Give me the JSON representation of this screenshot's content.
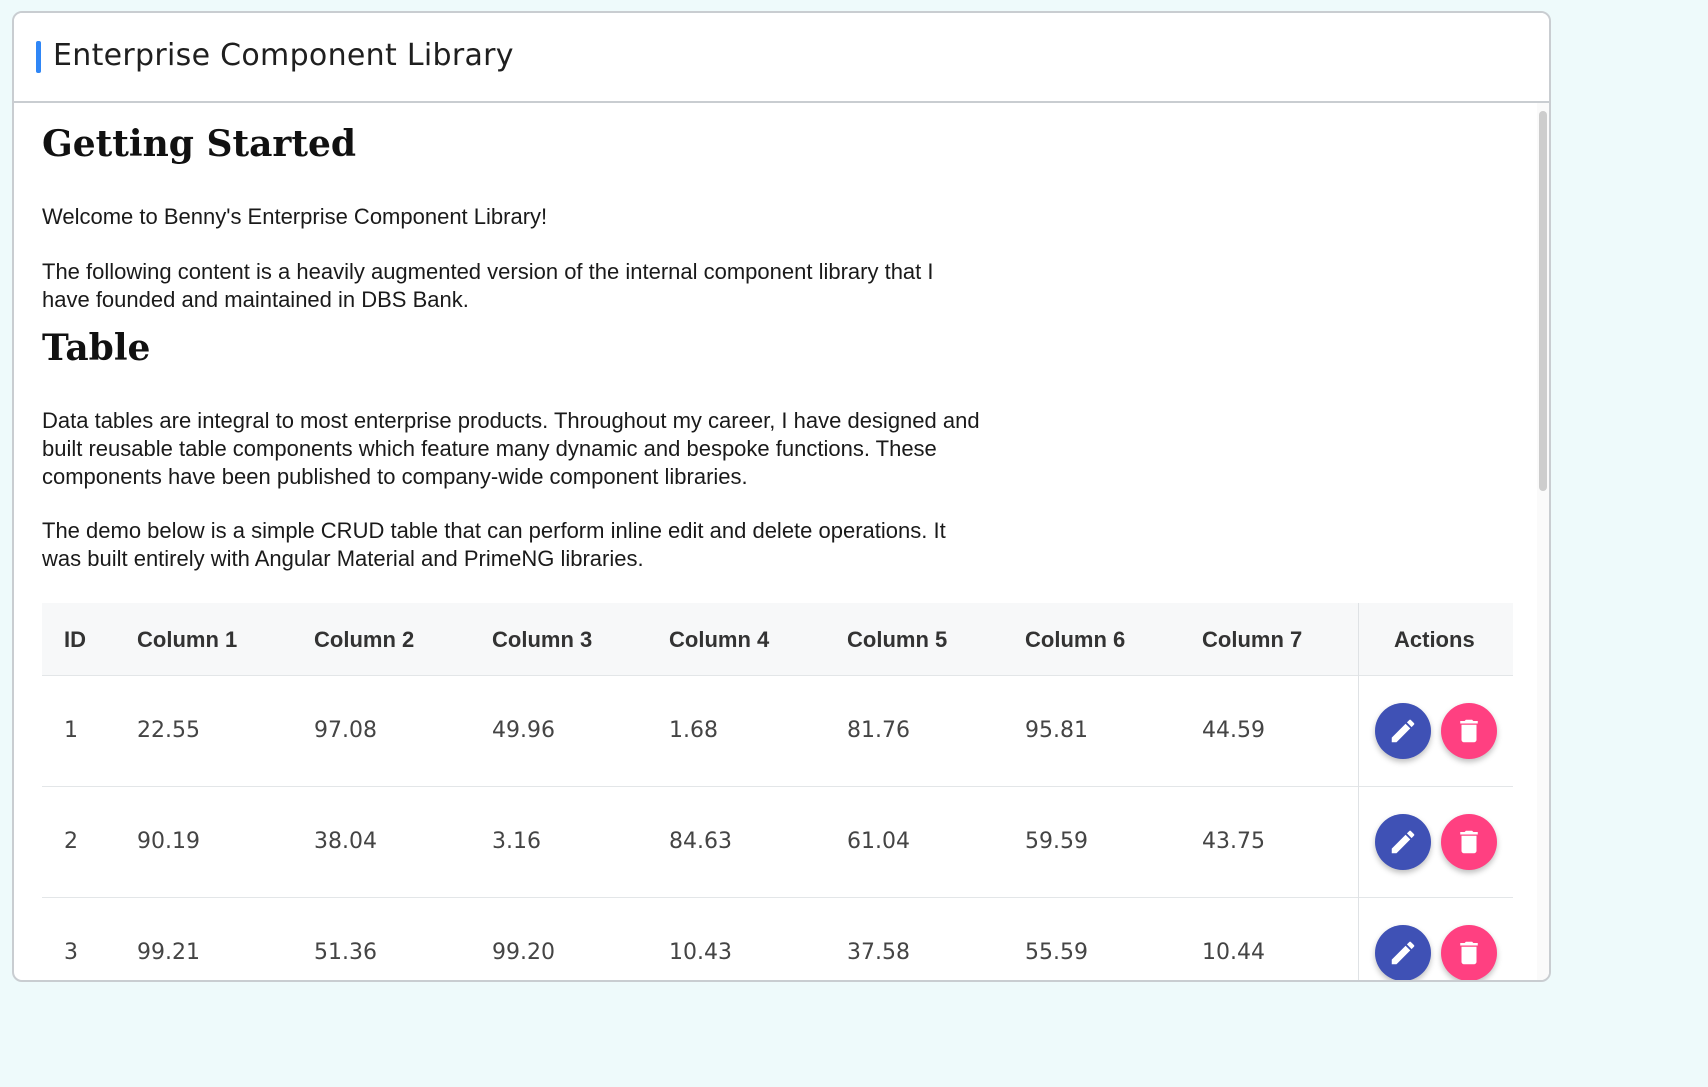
{
  "app": {
    "title": "Enterprise Component Library"
  },
  "colors": {
    "accent": "#2f86f6",
    "edit": "#3f51b5",
    "delete": "#ff4081"
  },
  "sections": {
    "getting_started": {
      "heading": "Getting Started",
      "p1": "Welcome to Benny's Enterprise Component Library!",
      "p2": "The following content is a heavily augmented version of the internal component library that I have founded and maintained in DBS Bank."
    },
    "table": {
      "heading": "Table",
      "p1": "Data tables are integral to most enterprise products. Throughout my career, I have designed and built reusable table components which feature many dynamic and bespoke functions. These components have been published to company-wide component libraries.",
      "p2": "The demo below is a simple CRUD table that can perform inline edit and delete operations. It was built entirely with Angular Material and PrimeNG libraries."
    }
  },
  "table": {
    "headers": [
      "ID",
      "Column 1",
      "Column 2",
      "Column 3",
      "Column 4",
      "Column 5",
      "Column 6",
      "Column 7",
      "Actions"
    ],
    "rows": [
      [
        "1",
        "22.55",
        "97.08",
        "49.96",
        "1.68",
        "81.76",
        "95.81",
        "44.59"
      ],
      [
        "2",
        "90.19",
        "38.04",
        "3.16",
        "84.63",
        "61.04",
        "59.59",
        "43.75"
      ],
      [
        "3",
        "99.21",
        "51.36",
        "99.20",
        "10.43",
        "37.58",
        "55.59",
        "10.44"
      ]
    ],
    "row_actions": {
      "edit_icon": "pencil-icon",
      "delete_icon": "trash-icon"
    }
  }
}
